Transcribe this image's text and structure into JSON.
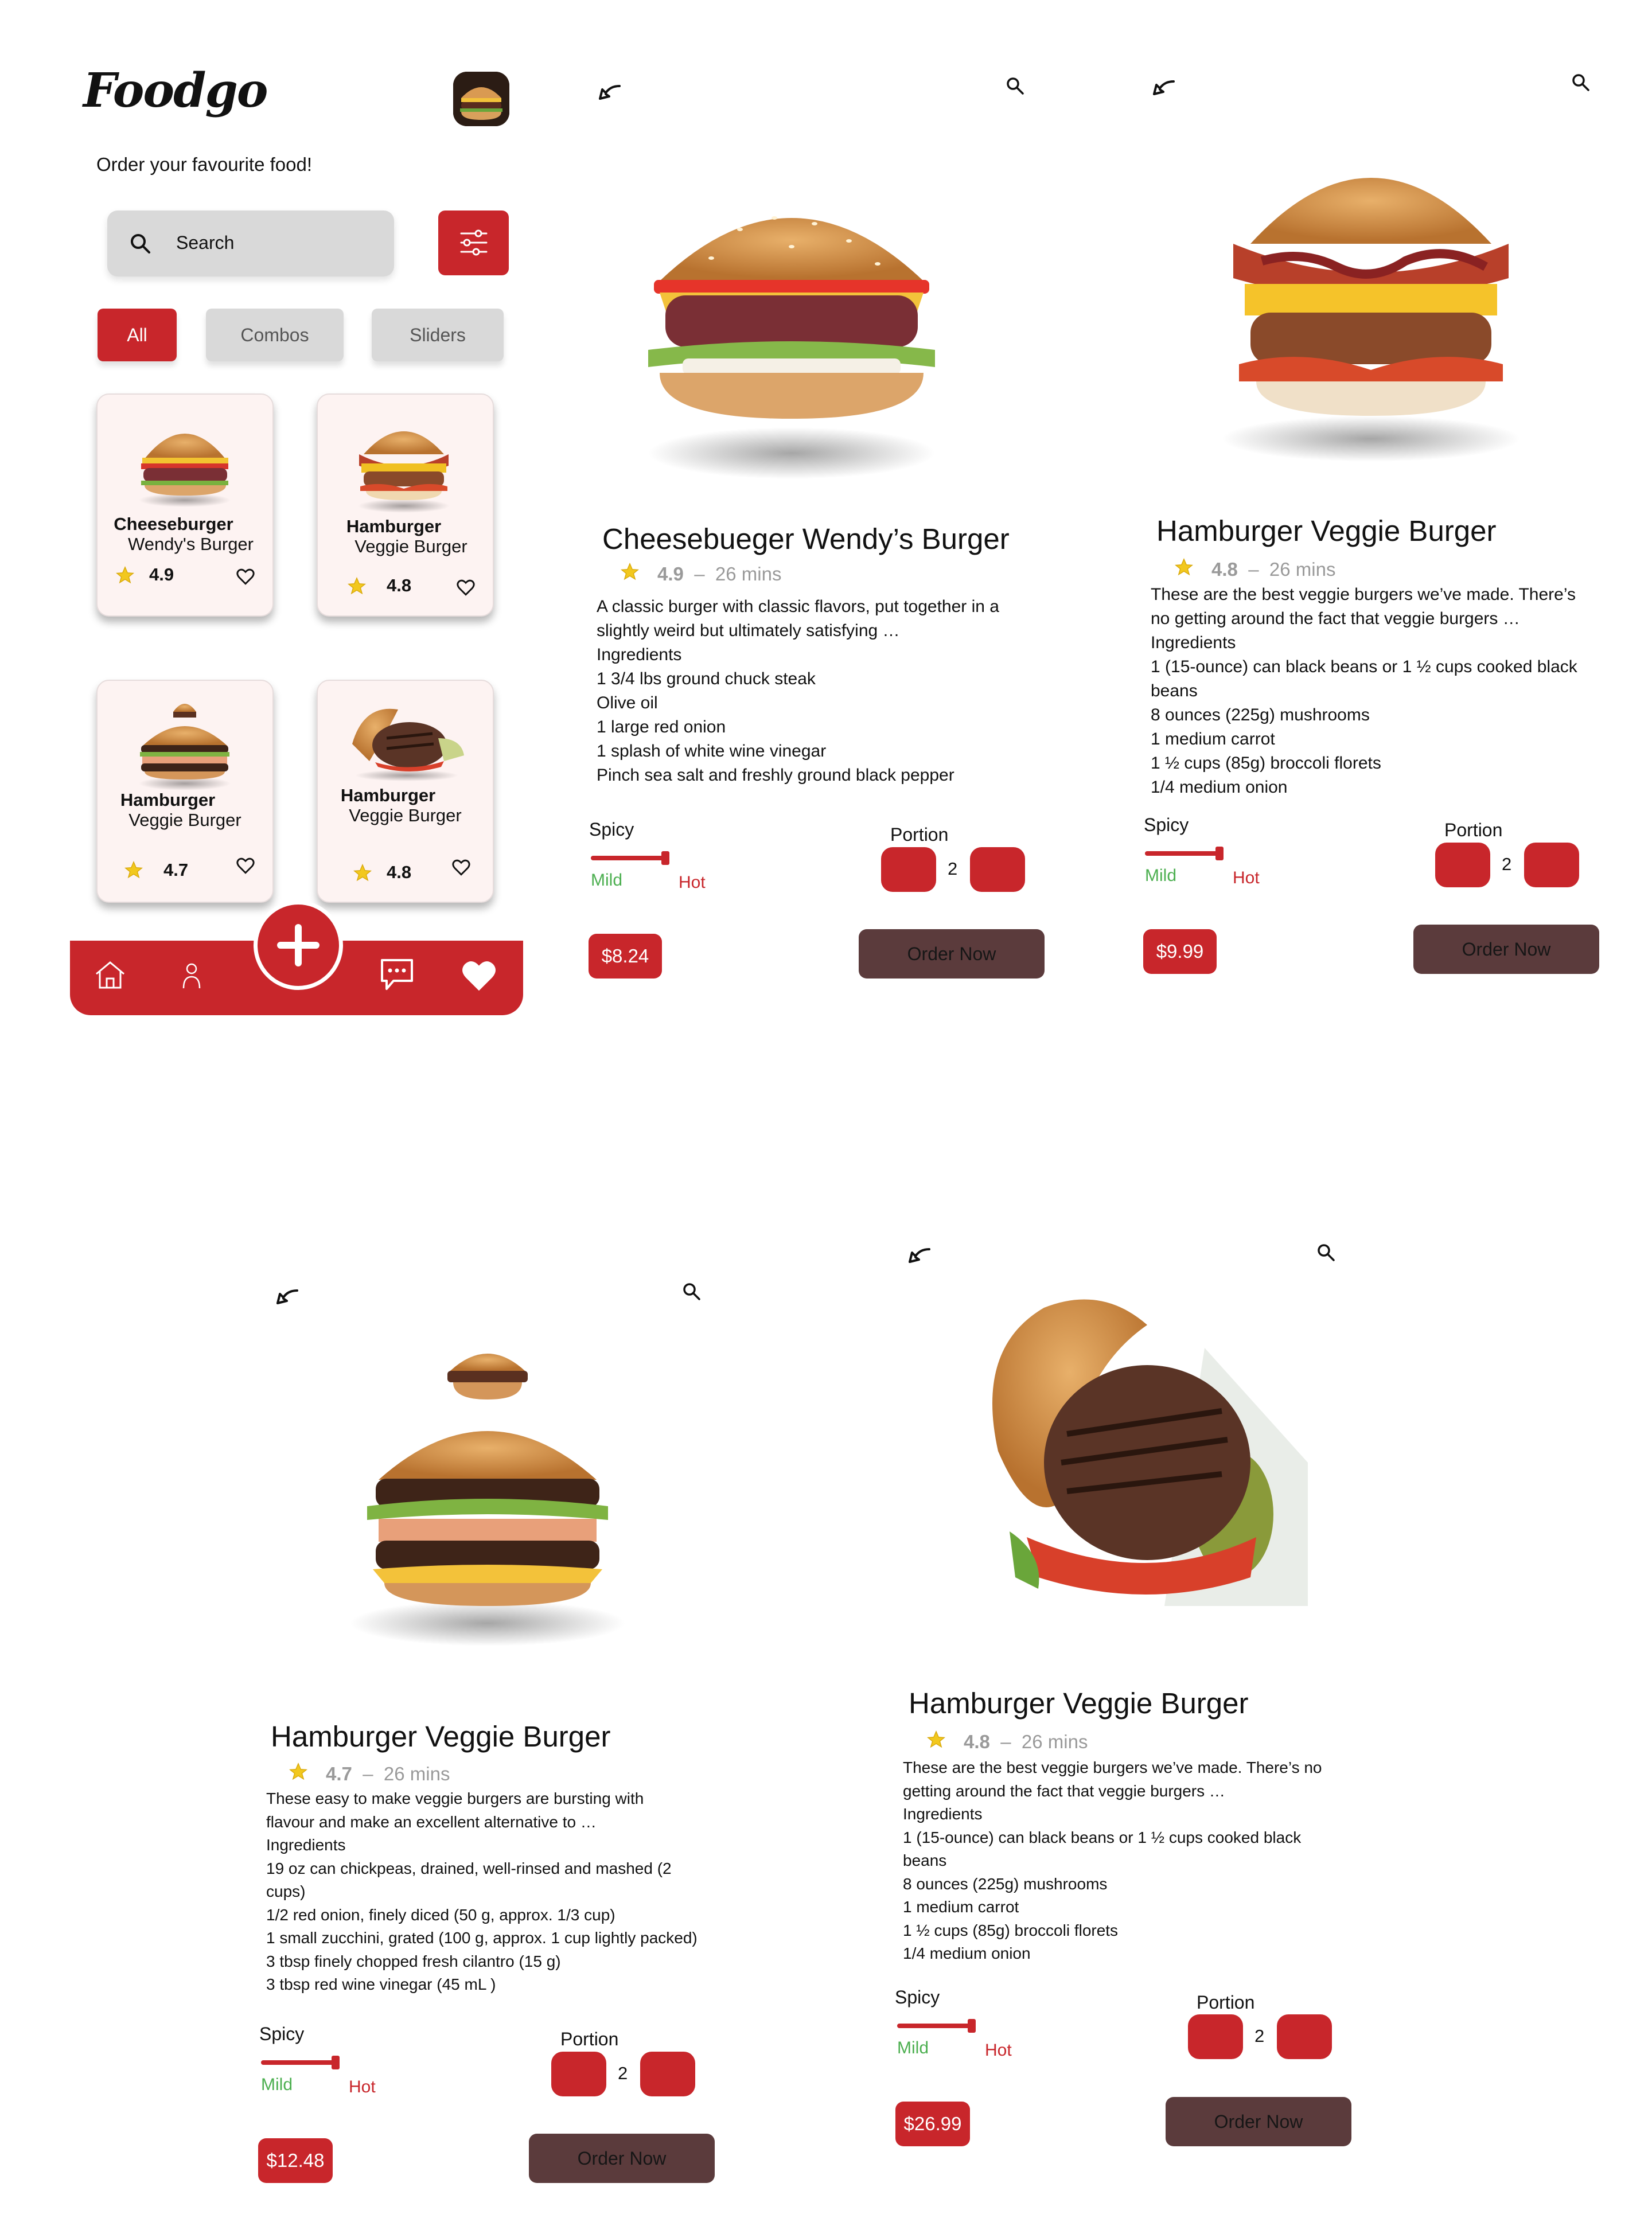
{
  "colors": {
    "primary": "#c8262b",
    "order_button": "#5b3b3c",
    "chip_idle": "#d9d9d9",
    "card_bg": "#fdf3f2",
    "mild_green": "#4caf50",
    "star": "#f2c81e"
  },
  "home": {
    "logo": "Foodgo",
    "subtitle": "Order your favourite food!",
    "search": {
      "placeholder": "Search",
      "icon": "search-icon"
    },
    "filter_icon": "sliders-icon",
    "chips": [
      "All",
      "Combos",
      "Sliders"
    ],
    "cards": [
      {
        "name": "Cheeseburger",
        "sub": "Wendy's Burger",
        "rating": "4.9"
      },
      {
        "name": "Hamburger",
        "sub": "Veggie Burger",
        "rating": "4.8"
      },
      {
        "name": "Hamburger",
        "sub": "Veggie Burger",
        "rating": "4.7"
      },
      {
        "name": "Hamburger",
        "sub": "Veggie Burger",
        "rating": "4.8"
      }
    ],
    "nav_icons": [
      "home-icon",
      "user-icon",
      "add-icon",
      "chat-icon",
      "heart-icon"
    ]
  },
  "details": [
    {
      "title": "Cheesebueger Wendy’s Burger",
      "rating": "4.9",
      "time": "26 mins",
      "lines": [
        "A classic burger with classic flavors, put together in a",
        "slightly weird but ultimately satisfying …",
        "Ingredients",
        "1 3/4 lbs ground chuck steak",
        "Olive oil",
        "1 large red onion",
        "1 splash of white wine vinegar",
        "Pinch sea salt and freshly ground black pepper"
      ],
      "spicy_label": "Spicy",
      "mild": "Mild",
      "hot": "Hot",
      "spicy_level": 1.0,
      "portion_label": "Portion",
      "portion": "2",
      "price": "$8.24",
      "order": "Order Now"
    },
    {
      "title": "Hamburger Veggie Burger",
      "rating": "4.8",
      "time": "26 mins",
      "lines": [
        "These are the best veggie burgers we’ve made. There’s",
        "no getting around the fact that veggie burgers …",
        "Ingredients",
        "1 (15-ounce) can black beans or 1 ½ cups cooked black",
        "beans",
        "8 ounces (225g) mushrooms",
        "1 medium carrot",
        "1 ½ cups (85g) broccoli florets",
        "1/4 medium onion"
      ],
      "spicy_label": "Spicy",
      "mild": "Mild",
      "hot": "Hot",
      "spicy_level": 1.0,
      "portion_label": "Portion",
      "portion": "2",
      "price": "$9.99",
      "order": "Order Now"
    },
    {
      "title": "Hamburger Veggie Burger",
      "rating": "4.7",
      "time": "26 mins",
      "lines": [
        "These easy to make veggie burgers are bursting with",
        "flavour and make an excellent alternative to …",
        "Ingredients",
        "19 oz can chickpeas, drained, well-rinsed and mashed (2",
        "cups)",
        "1/2 red onion, finely diced (50 g, approx. 1/3 cup)",
        "1 small zucchini, grated (100 g, approx. 1 cup lightly packed)",
        "3 tbsp finely chopped fresh cilantro (15 g)",
        "3 tbsp red wine vinegar (45 mL )"
      ],
      "spicy_label": "Spicy",
      "mild": "Mild",
      "hot": "Hot",
      "spicy_level": 1.0,
      "portion_label": "Portion",
      "portion": "2",
      "price": "$12.48",
      "order": "Order Now"
    },
    {
      "title": "Hamburger Veggie Burger",
      "rating": "4.8",
      "time": "26 mins",
      "lines": [
        "These are the best veggie burgers we’ve made. There’s no",
        "getting around the fact that veggie burgers …",
        "Ingredients",
        "1 (15-ounce) can black beans or 1 ½ cups cooked black",
        "beans",
        "8 ounces (225g) mushrooms",
        "1 medium carrot",
        "1 ½ cups (85g) broccoli florets",
        "1/4 medium onion"
      ],
      "spicy_label": "Spicy",
      "mild": "Mild",
      "hot": "Hot",
      "spicy_level": 1.0,
      "portion_label": "Portion",
      "portion": "2",
      "price": "$26.99",
      "order": "Order Now"
    }
  ]
}
